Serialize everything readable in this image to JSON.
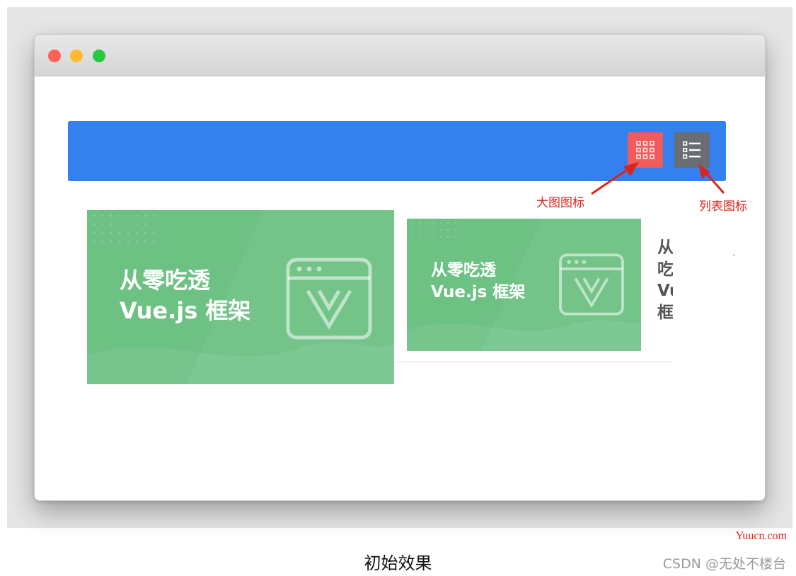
{
  "toolbar": {
    "color": "#3480ef",
    "grid_button": {
      "icon": "grid-view-icon",
      "color": "#f25b5b"
    },
    "list_button": {
      "icon": "list-view-icon",
      "color": "#6a6d73"
    }
  },
  "annotations": {
    "grid_label": "大图图标",
    "list_label": "列表图标",
    "color": "#d9251c"
  },
  "cards": [
    {
      "line1": "从零吃透",
      "line2": "Vue.js 框架",
      "color": "#6cc183"
    },
    {
      "line1": "从零吃透",
      "line2": "Vue.js 框架",
      "color": "#6cc183"
    }
  ],
  "overflow_text": [
    "从",
    "吃",
    "Vu",
    "框"
  ],
  "caption": "初始效果",
  "watermarks": {
    "site": "Yuucn.com",
    "csdn": "CSDN @无处不楼台"
  }
}
